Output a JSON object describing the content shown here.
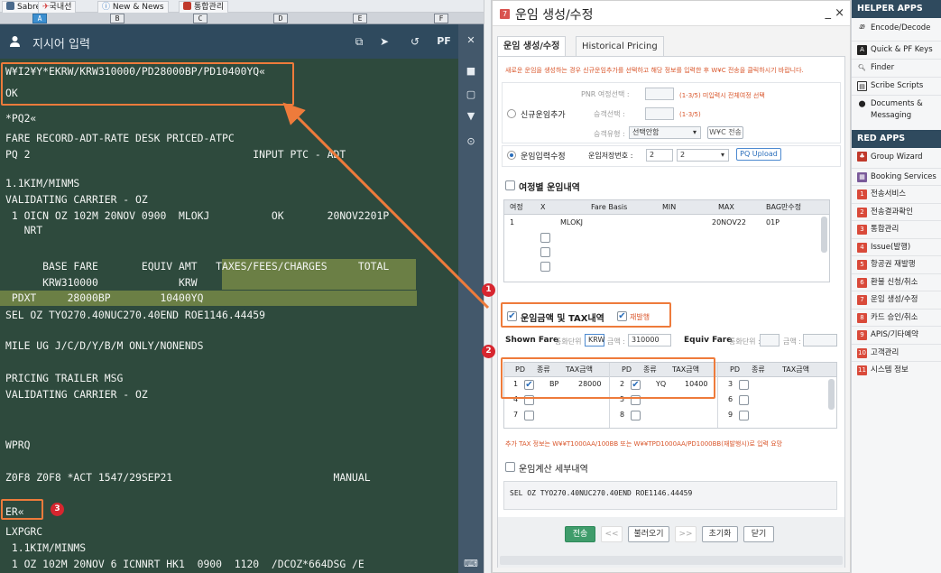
{
  "tabs": [
    {
      "label": "Sabre",
      "icon": "sabre-icon",
      "color": "#4a6a8c"
    },
    {
      "label": "국내선",
      "icon": "plane-icon",
      "color": "#d23c3c"
    },
    {
      "label": "New & News",
      "icon": "info-icon",
      "color": "#3d7ec4"
    },
    {
      "label": "통합관리",
      "icon": "grid-icon",
      "color": "#c0392b"
    }
  ],
  "column_headers": [
    "A",
    "B",
    "C",
    "D",
    "E",
    "F"
  ],
  "input_bar": {
    "placeholder_label": "지시어 입력",
    "pf_label": "PF"
  },
  "terminal": {
    "lines": [
      "W¥I2¥Y*EKRW/KRW310000/PD28000BP/PD10400YQ«",
      "OK",
      "*PQ2«",
      "FARE RECORD-ADT-RATE DESK PRICED-ATPC",
      "PQ 2                                    INPUT PTC - ADT",
      "1.1KIM/MINMS",
      "VALIDATING CARRIER - OZ",
      " 1 OICN OZ 102M 20NOV 0900  MLOKJ          OK       20NOV2201P",
      "   NRT",
      "      BASE FARE       EQUIV AMT   TAXES/FEES/CHARGES     TOTAL",
      "      KRW310000             KRW",
      " PDXT     28000BP        10400YQ",
      "SEL OZ TYO270.40NUC270.40END ROE1146.44459",
      "MILE UG J/C/D/Y/B/M ONLY/NONENDS",
      "PRICING TRAILER MSG",
      "VALIDATING CARRIER - OZ",
      "WPRQ",
      "Z0F8 Z0F8 *ACT 1547/29SEP21                          MANUAL",
      "ER«",
      "LXPGRC",
      " 1.1KIM/MINMS",
      " 1 OZ 102M 20NOV 6 ICNNRT HK1  0900  1120  /DCOZ*664DSG /E"
    ]
  },
  "annotations": {
    "badge1": "1",
    "badge2": "2",
    "badge3": "3"
  },
  "dialog": {
    "title": "운임 생성/수정",
    "close_label": "_ ×",
    "tabs": [
      "운임 생성/수정",
      "Historical Pricing"
    ],
    "notice": "새로운 운임을 생성하는 경우 신규운임추가를 선택하고 해당 정보를 입력한 후 W¥C 전송을 클릭하시기 바랍니다.",
    "new_fare": {
      "radio_label": "신규운임추가",
      "pnr_label": "PNR 여정선택 :",
      "pnr_hint": "(1-3/5) 미입력시 전체여정 선택",
      "pax_label": "승객선택 :",
      "pax_hint": "(1-3/5)",
      "paxtype_label": "승객유형 :",
      "paxtype_value": "선택안함",
      "wc_button": "W¥C 전송"
    },
    "edit_fare": {
      "radio_label": "운임입력수정",
      "store_label": "운임저장번호 :",
      "store_value": "2",
      "store_select": "2",
      "upload_button": "PQ Upload"
    },
    "itin_section": {
      "label": "여정별 운임내역",
      "headers": [
        "여정",
        "X",
        "Fare Basis",
        "MIN",
        "MAX",
        "BAG만수정"
      ],
      "row": {
        "itin": "1",
        "fare_basis": "MLOKJ",
        "min": "",
        "max": "20NOV22",
        "bag": "01P"
      }
    },
    "tax_section": {
      "label": "운임금액 및 TAX내역",
      "reissue_label": "재발행",
      "shown_fare_label": "Shown Fare",
      "currency_label": "통화단위 :",
      "currency_value": "KRW",
      "amount_label": "금액 :",
      "amount_value": "310000",
      "equiv_label": "Equiv Fare",
      "equiv_currency_label": "통화단위 :",
      "equiv_amount_label": "금액 :",
      "headers": [
        "PD",
        "종류",
        "TAX금액",
        "PD",
        "종류",
        "TAX금액",
        "PD",
        "종류",
        "TAX금액"
      ],
      "rows": [
        [
          {
            "n": "1",
            "checked": true,
            "type": "BP",
            "amt": "28000"
          },
          {
            "n": "2",
            "checked": true,
            "type": "YQ",
            "amt": "10400"
          },
          {
            "n": "3",
            "checked": false,
            "type": "",
            "amt": ""
          }
        ],
        [
          {
            "n": "4",
            "checked": false,
            "type": "",
            "amt": ""
          },
          {
            "n": "5",
            "checked": false,
            "type": "",
            "amt": ""
          },
          {
            "n": "6",
            "checked": false,
            "type": "",
            "amt": ""
          }
        ],
        [
          {
            "n": "7",
            "checked": false,
            "type": "",
            "amt": ""
          },
          {
            "n": "8",
            "checked": false,
            "type": "",
            "amt": ""
          },
          {
            "n": "9",
            "checked": false,
            "type": "",
            "amt": ""
          }
        ]
      ],
      "notice": "추가 TAX 정보는 W¥¥T1000AA/100BB 또는 W¥¥TPD1000AA/PD1000BB(재발행시)로 입력 요망"
    },
    "calc_section": {
      "label": "운임계산 세부내역",
      "text": "SEL OZ TYO270.40NUC270.40END ROE1146.44459"
    },
    "footer": {
      "send": "전송",
      "prev": "<<",
      "load": "불러오기",
      "next": ">>",
      "reset": "초기화",
      "close": "닫기"
    }
  },
  "side": {
    "helper_title": "HELPER APPS",
    "helper_items": [
      {
        "label": "Encode/Decode",
        "icon": "encode-icon"
      },
      {
        "label": "Quick & PF Keys",
        "icon": "keys-icon"
      },
      {
        "label": "Finder",
        "icon": "search-icon"
      },
      {
        "label": "Scribe Scripts",
        "icon": "script-icon"
      },
      {
        "label": "Documents & Messaging",
        "icon": "pin-icon"
      }
    ],
    "red_title": "RED APPS",
    "red_items": [
      {
        "label": "Group Wizard",
        "icon": "group-icon"
      },
      {
        "label": "Booking Services",
        "icon": "booking-icon"
      },
      {
        "label": "전송서비스",
        "num": "1"
      },
      {
        "label": "전송결과확인",
        "num": "2"
      },
      {
        "label": "통합관리",
        "num": "3"
      },
      {
        "label": "Issue(발행)",
        "num": "4"
      },
      {
        "label": "항공권 재발행",
        "num": "5"
      },
      {
        "label": "환불 신청/취소",
        "num": "6"
      },
      {
        "label": "운임 생성/수정",
        "num": "7"
      },
      {
        "label": "카드 승인/취소",
        "num": "8"
      },
      {
        "label": "APIS/기타예약",
        "num": "9"
      },
      {
        "label": "고객관리",
        "num": "10"
      },
      {
        "label": "시스템 정보",
        "num": "11"
      }
    ],
    "colors": {
      "header": "#2f4a5e",
      "red_item": "#d94a3a"
    }
  }
}
